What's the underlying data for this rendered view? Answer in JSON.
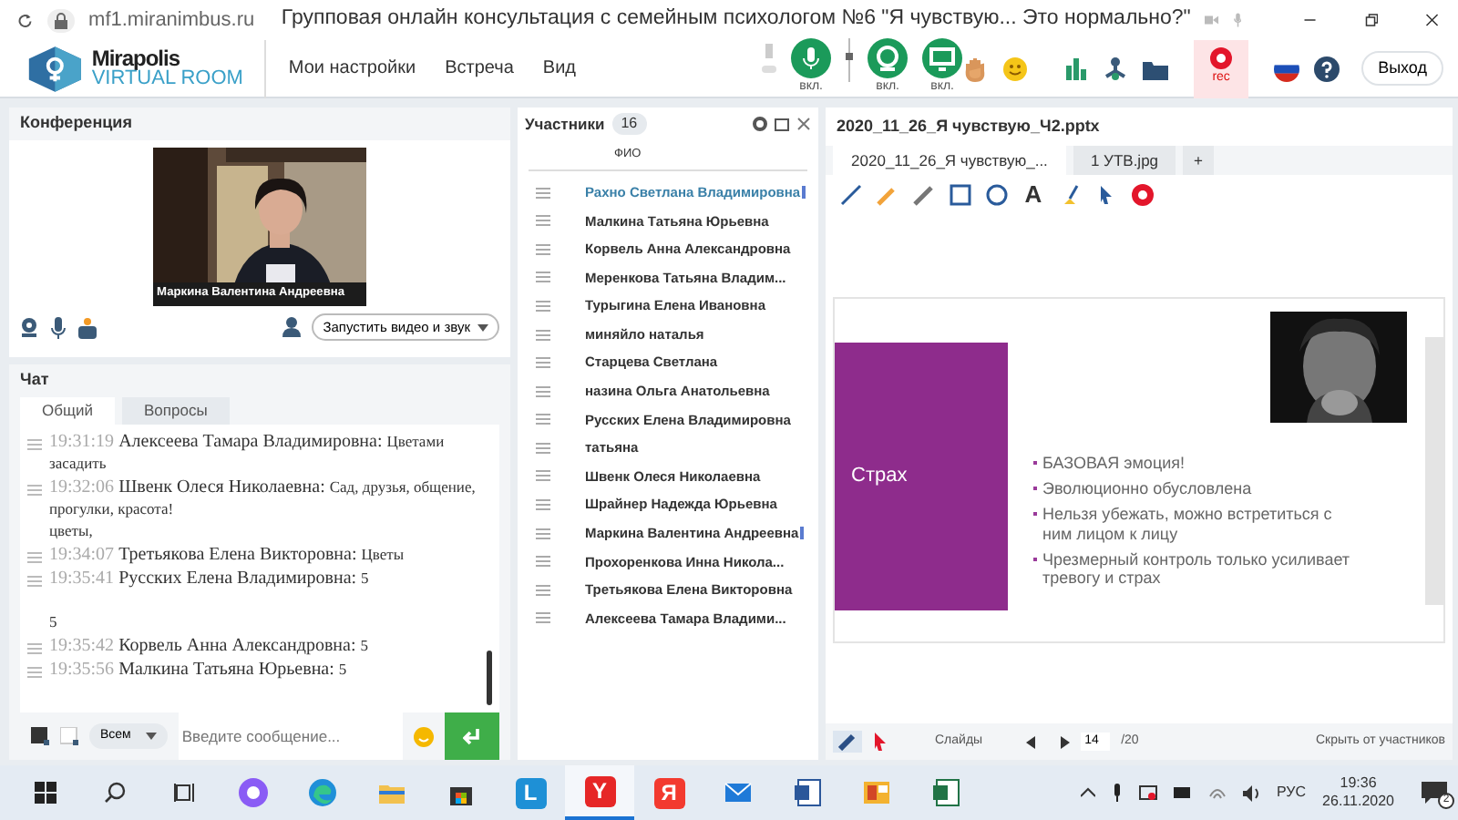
{
  "browser": {
    "url": "mf1.miranimbus.ru",
    "title": "Групповая онлайн консультация с семейным психологом №6 \"Я чувствую... Это нормально?\""
  },
  "app": {
    "logo_title": "Mirapolis",
    "logo_subtitle": "VIRTUAL ROOM",
    "menu": [
      "Мои настройки",
      "Встреча",
      "Вид"
    ],
    "media": [
      {
        "kind": "mic",
        "label": "вкл.",
        "on": true
      },
      {
        "kind": "camera",
        "label": "вкл.",
        "on": true
      },
      {
        "kind": "screen",
        "label": "вкл.",
        "on": true
      }
    ],
    "volume": {
      "level": 0.6
    },
    "rec": "rec",
    "exit": "Выход"
  },
  "conference": {
    "title": "Конференция",
    "video_caption": "Маркина Валентина  Андреевна",
    "start_button": "Запустить видео и звук"
  },
  "chat": {
    "title": "Чат",
    "tabs": [
      {
        "label": "Общий",
        "selected": true
      },
      {
        "label": "Вопросы",
        "selected": false
      }
    ],
    "messages": [
      {
        "time": "19:31:19",
        "author": "Алексеева   Тамара  Владимировна:",
        "text": "Цветами засадить"
      },
      {
        "time": "19:32:06",
        "author": "Швенк  Олеся Николаевна:",
        "text": "Сад, друзья, общение, прогулки, красота!\nцветы,"
      },
      {
        "time": "19:34:07",
        "author": "Третьякова  Елена Викторовна:",
        "text": "Цветы"
      },
      {
        "time": "19:35:41",
        "author": "Русских Елена Владимировна:",
        "text": "5\n\n5"
      },
      {
        "time": "19:35:42",
        "author": "Корвель Анна  Александровна:",
        "text": "5"
      },
      {
        "time": "19:35:56",
        "author": "Малкина Татьяна  Юрьевна:",
        "text": "5"
      }
    ],
    "recipient": "Всем",
    "placeholder": "Введите сообщение..."
  },
  "participants": {
    "title": "Участники",
    "count": "16",
    "column": "ФИО",
    "rows": [
      {
        "name": "Рахно Светлана  Владимировна",
        "highlighted": true,
        "speaking": true
      },
      {
        "name": "Малкина Татьяна  Юрьевна",
        "highlighted": false,
        "speaking": false
      },
      {
        "name": "Корвель Анна  Александровна",
        "highlighted": false,
        "speaking": false
      },
      {
        "name": "Меренкова  Татьяна  Владим...",
        "highlighted": false,
        "speaking": false
      },
      {
        "name": "Турыгина  Елена  Ивановна",
        "highlighted": false,
        "speaking": false
      },
      {
        "name": "миняйло  наталья",
        "highlighted": false,
        "speaking": false
      },
      {
        "name": "Старцева  Светлана",
        "highlighted": false,
        "speaking": false
      },
      {
        "name": "назина  Ольга Анатольевна",
        "highlighted": false,
        "speaking": false
      },
      {
        "name": "Русских Елена Владимировна",
        "highlighted": false,
        "speaking": false
      },
      {
        "name": "татьяна",
        "highlighted": false,
        "speaking": false
      },
      {
        "name": "Швенк  Олеся Николаевна",
        "highlighted": false,
        "speaking": false
      },
      {
        "name": "Шрайнер Надежда  Юрьевна",
        "highlighted": false,
        "speaking": false
      },
      {
        "name": "Маркина Валентина  Андреевна",
        "highlighted": false,
        "speaking": true
      },
      {
        "name": "Прохоренкова  Инна   Никола...",
        "highlighted": false,
        "speaking": false
      },
      {
        "name": "Третьякова  Елена Викторовна",
        "highlighted": false,
        "speaking": false
      },
      {
        "name": "Алексеева  Тамара  Владими...",
        "highlighted": false,
        "speaking": false
      }
    ]
  },
  "presentation": {
    "title": "2020_11_26_Я чувствую_Ч2.pptx",
    "tabs": [
      {
        "label": "2020_11_26_Я чувствую_...",
        "selected": true
      },
      {
        "label": "1 УТВ.jpg",
        "selected": false
      }
    ],
    "add": "+",
    "tools": [
      {
        "kind": "line"
      },
      {
        "kind": "marker"
      },
      {
        "kind": "pencil"
      },
      {
        "kind": "rect"
      },
      {
        "kind": "circle"
      },
      {
        "kind": "text",
        "label": "A"
      },
      {
        "kind": "fill"
      },
      {
        "kind": "pointer"
      },
      {
        "kind": "stop"
      }
    ],
    "slide": {
      "title": "Страх",
      "bullets": [
        "БАЗОВАЯ эмоция!",
        "Эволюционно обусловлена",
        "Нельзя убежать, можно встретиться с ним лицом к лицу",
        "Чрезмерный контроль только усиливает тревогу и страх"
      ]
    },
    "footer": {
      "slides_label": "Слайды",
      "page": "14",
      "total": "/20",
      "hide": "Скрыть от участников"
    }
  },
  "taskbar": {
    "apps": [
      {
        "kind": "alice"
      },
      {
        "kind": "edge"
      },
      {
        "kind": "folder"
      },
      {
        "kind": "store"
      },
      {
        "kind": "letter",
        "label": "L",
        "color": "#1e90d6"
      },
      {
        "kind": "letter",
        "label": "Y",
        "color": "#e62727",
        "selected": true
      },
      {
        "kind": "letter",
        "label": "Я",
        "color": "#f33a2f"
      },
      {
        "kind": "mail"
      },
      {
        "kind": "word"
      },
      {
        "kind": "slides"
      },
      {
        "kind": "excel"
      }
    ],
    "lang": "РУС",
    "time": "19:36",
    "date": "26.11.2020",
    "notifications": "2"
  }
}
